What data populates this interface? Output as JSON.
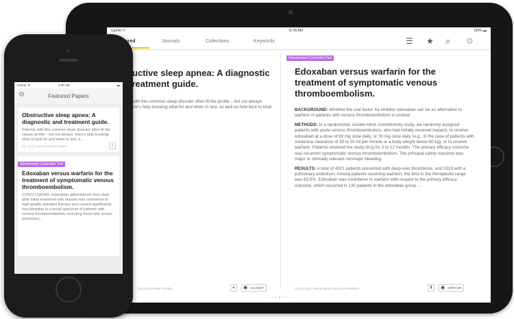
{
  "ipad": {
    "status": {
      "carrier": "Carrier ᯤ",
      "time": "11:45 AM",
      "battery": "100% ▬"
    },
    "tabs": [
      {
        "label": "Featured"
      },
      {
        "label": "Journals"
      },
      {
        "label": "Collections"
      },
      {
        "label": "Keywords"
      }
    ],
    "toolbar_icons": {
      "list": "☰",
      "star": "★",
      "search": "⌕",
      "settings": "⚙"
    },
    "left": {
      "title": "ructive sleep apnea: A diagnostic treatment guide.",
      "summary": "s with this common sleep disorder often fit the profile – but not always. Here's help knowing what for and when to test, as well as how best to treat it.",
      "footer": "Journal of Family Practice"
    },
    "right": {
      "tag": "Randomized Controlled Trial",
      "title": "Edoxaban versus warfarin for the treatment of symptomatic venous thromboembolism.",
      "background_label": "BACKGROUND:",
      "background_text": "Whether the oral factor Xa inhibitor edoxaban can be an alternative to warfarin in patients with venous thromboembolism is unclear.",
      "methods_label": "METHODS:",
      "methods_text": "In a randomized, double-blind, noninferiority study, we randomly assigned patients with acute venous thromboembolism, who had initially received heparin, to receive edoxaban at a dose of 60 mg once daily, or 30 mg once daily (e.g., in the case of patients with creatinine clearance of 30 to 50 ml per minute or a body weight below 60 kg), or to receive warfarin. Patients received the study drug for 3 to 12 months. The primary efficacy outcome was recurrent symptomatic venous thromboembolism. The principal safety outcome was major or clinically relevant nonmajor bleeding.",
      "results_label": "RESULTS:",
      "results_text": "A total of 4921 patients presented with deep-vein thrombosis, and 3319 with a pulmonary embolism. Among patients receiving warfarin, the time in the therapeutic range was 63.5%. Edoxaban was noninferior to warfarin with respect to the primary efficacy outcome, which occurred in 130 patients in the edoxaban group ...",
      "footer": "Oct 10 2013, New England Journal of Medicine",
      "view_id": "23997438"
    },
    "left_view_id": "24143347",
    "page_dots": "• • ● • • •"
  },
  "iphone": {
    "status": {
      "carrier": "Carrier ᯤ",
      "time": "4:30 AM",
      "battery": "▬"
    },
    "nav_title": "Featured Papers",
    "cards": [
      {
        "title": "Obstructive sleep apnea: A diagnostic and treatment guide.",
        "text": "Patients with this common sleep disorder often fit the classic profile – but not always. Here's help knowing what to look for and when to test, a...",
        "footer": "Oct. 2013, Journal of Family Practice",
        "tag": ""
      },
      {
        "tag": "Randomized Controlled Trial",
        "title": "Edoxaban versus warfarin for the treatment of symptomatic venous thromboembolism.",
        "text": "CONCLUSIONS: Edoxaban administered once daily after initial treatment with heparin was noninferior to high-quality standard therapy and caused significantly less bleeding in a broad spectrum of patients with venous thromboembolism, including those with severe pulmonary...",
        "footer": ""
      }
    ]
  },
  "colors": {
    "accent": "#f3c300",
    "tag": "#b86be0",
    "device": "#161616"
  }
}
